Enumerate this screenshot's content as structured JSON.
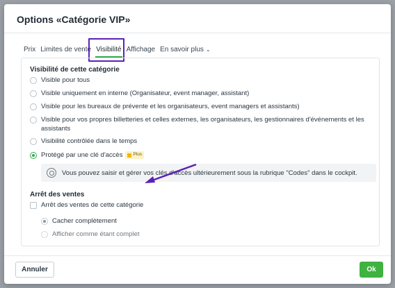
{
  "dialog": {
    "title": "Options «Catégorie VIP»"
  },
  "tabs": [
    {
      "label": "Prix"
    },
    {
      "label": "Limites de vente"
    },
    {
      "label": "Visibilité"
    },
    {
      "label": "Affichage"
    },
    {
      "label": "En savoir plus"
    }
  ],
  "active_tab": "Visibilité",
  "visibility": {
    "title": "Visibilité de cette catégorie",
    "options": [
      {
        "label": "Visible pour tous",
        "selected": false
      },
      {
        "label": "Visible uniquement en interne (Organisateur, event manager, assistant)",
        "selected": false
      },
      {
        "label": "Visible pour les bureaux de prévente et les organisateurs, event managers et assistants)",
        "selected": false
      },
      {
        "label": "Visible pour vos propres billetteries et celles externes, les organisateurs, les gestionnaires d'événements et les",
        "label_line2": "assistants",
        "selected": false
      },
      {
        "label": "Visibilité contrôlée dans le temps",
        "selected": false
      },
      {
        "label": "Protégé par une clé d'accès",
        "selected": true,
        "badge": "Plus"
      }
    ],
    "info": "Vous pouvez saisir et gérer vos clés d'accès ultérieurement sous la rubrique \"Codes\" dans le cockpit."
  },
  "sales_stop": {
    "title": "Arrêt des ventes",
    "checkbox_label": "Arrêt des ventes de cette catégorie",
    "checked": false,
    "options": [
      {
        "label": "Cacher complètement",
        "selected": true
      },
      {
        "label": "Afficher comme étant complet",
        "selected": false
      }
    ]
  },
  "footer": {
    "cancel_label": "Annuler",
    "ok_label": "Ok"
  },
  "colors": {
    "accent_green": "#34a853",
    "highlight_purple": "#5b21b6",
    "ok_button": "#3fb23f"
  },
  "icons": {
    "chevron": "chevron-down-icon",
    "info": "lifebuoy-icon",
    "badge": "plus-badge-icon",
    "annotation": "arrow-annotation-icon"
  }
}
